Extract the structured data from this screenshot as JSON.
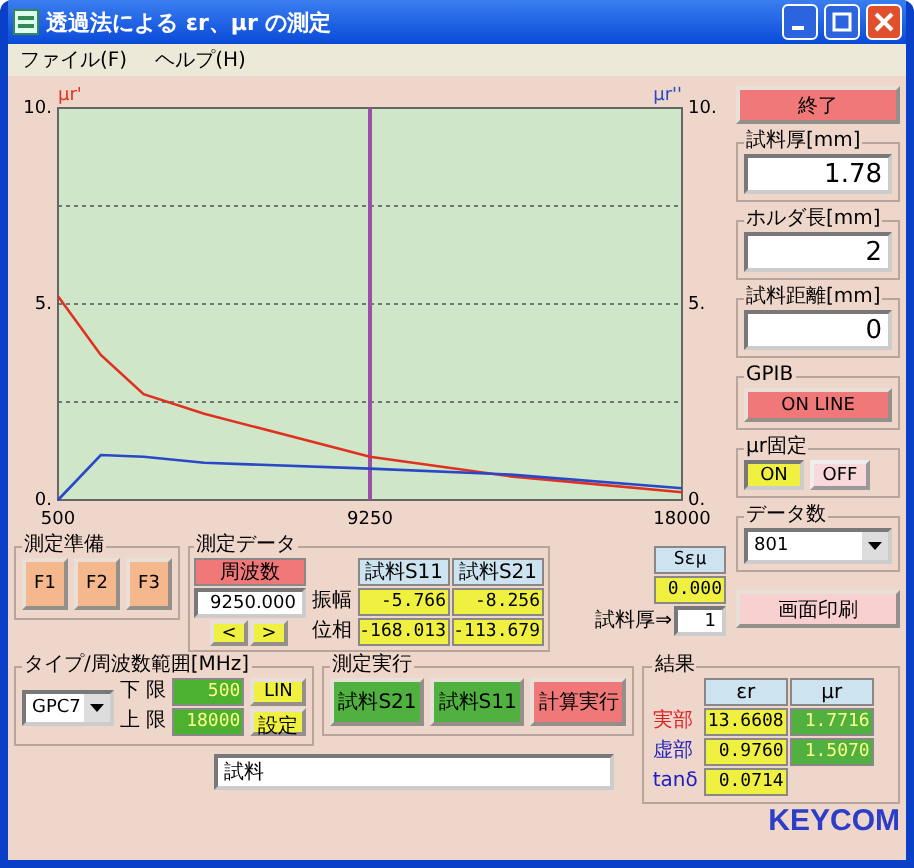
{
  "window": {
    "title": "透過法による εr、μr の測定"
  },
  "menu": [
    "ファイル(F)",
    "ヘルプ(H)"
  ],
  "chart": {
    "chart_data": {
      "type": "line",
      "x": [
        500,
        1700,
        2900,
        4600,
        9250,
        13200,
        18000
      ],
      "xlim": [
        500,
        18000
      ],
      "ylim": [
        0,
        10
      ],
      "xticks": [
        500,
        9250,
        18000
      ],
      "yticks": [
        {
          "value": 0,
          "label": "0."
        },
        {
          "value": 5,
          "label": "5."
        },
        {
          "value": 10,
          "label": "10."
        }
      ],
      "series": [
        {
          "name": "μr'",
          "color": "#e03020",
          "values": [
            5.2,
            3.7,
            2.7,
            2.2,
            1.1,
            0.6,
            0.2
          ]
        },
        {
          "name": "μr''",
          "color": "#2848c8",
          "values": [
            0,
            1.15,
            1.1,
            0.95,
            0.8,
            0.65,
            0.3
          ]
        }
      ],
      "ref_lines": [
        {
          "axis": "x",
          "value": 9250
        }
      ]
    }
  },
  "close_button": "終了",
  "sample_fields": [
    {
      "label": "試料厚[mm]",
      "value": "1.78"
    },
    {
      "label": "ホルダ長[mm]",
      "value": "2"
    },
    {
      "label": "試料距離[mm]",
      "value": "0"
    }
  ],
  "gpib": {
    "label": "GPIB",
    "button": "ON LINE"
  },
  "mr_fixed": {
    "label": "μr固定",
    "options": [
      {
        "label": "ON",
        "selected": true
      },
      {
        "label": "OFF",
        "selected": false
      }
    ]
  },
  "data_count": {
    "label": "データ数",
    "value": "801"
  },
  "print_button": "画面印刷",
  "prep": {
    "label": "測定準備",
    "buttons": [
      "F1",
      "F2",
      "F3"
    ]
  },
  "measure_data": {
    "label": "測定データ",
    "freq_label": "周波数",
    "freq_value": "9250.000",
    "nav": [
      "<",
      ">"
    ],
    "columns": [
      "試料S11",
      "試料S21"
    ],
    "rows": [
      {
        "label": "振幅",
        "values": [
          "-5.766",
          "-8.256"
        ]
      },
      {
        "label": "位相",
        "values": [
          "-168.013",
          "-113.679"
        ]
      }
    ],
    "se_label": "Sεμ",
    "se_value": "0.000",
    "thickness_label": "試料厚⇒",
    "thickness_value": "1"
  },
  "range": {
    "label": "タイプ/周波数範囲[MHz]",
    "type": "GPC7",
    "lower_label": "下 限",
    "lower": "500",
    "upper_label": "上 限",
    "upper": "18000",
    "lin_button": "LIN",
    "set_button": "設定"
  },
  "run": {
    "label": "測定実行",
    "buttons": [
      {
        "label": "試料S21",
        "kind": "measure"
      },
      {
        "label": "試料S11",
        "kind": "measure"
      },
      {
        "label": "計算実行",
        "kind": "calc"
      }
    ]
  },
  "result": {
    "label": "結果",
    "columns": [
      "εr",
      "μr"
    ],
    "rows": [
      {
        "label": "実部",
        "color": "#e02020",
        "values": [
          "13.6608",
          "1.7716"
        ]
      },
      {
        "label": "虚部",
        "color": "#2020c0",
        "values": [
          "0.9760",
          "1.5070"
        ]
      },
      {
        "label": "tanδ",
        "color": "#2020c0",
        "values": [
          "0.0714"
        ]
      }
    ]
  },
  "comment": {
    "value": "試料"
  },
  "logo": "KEYCOM"
}
